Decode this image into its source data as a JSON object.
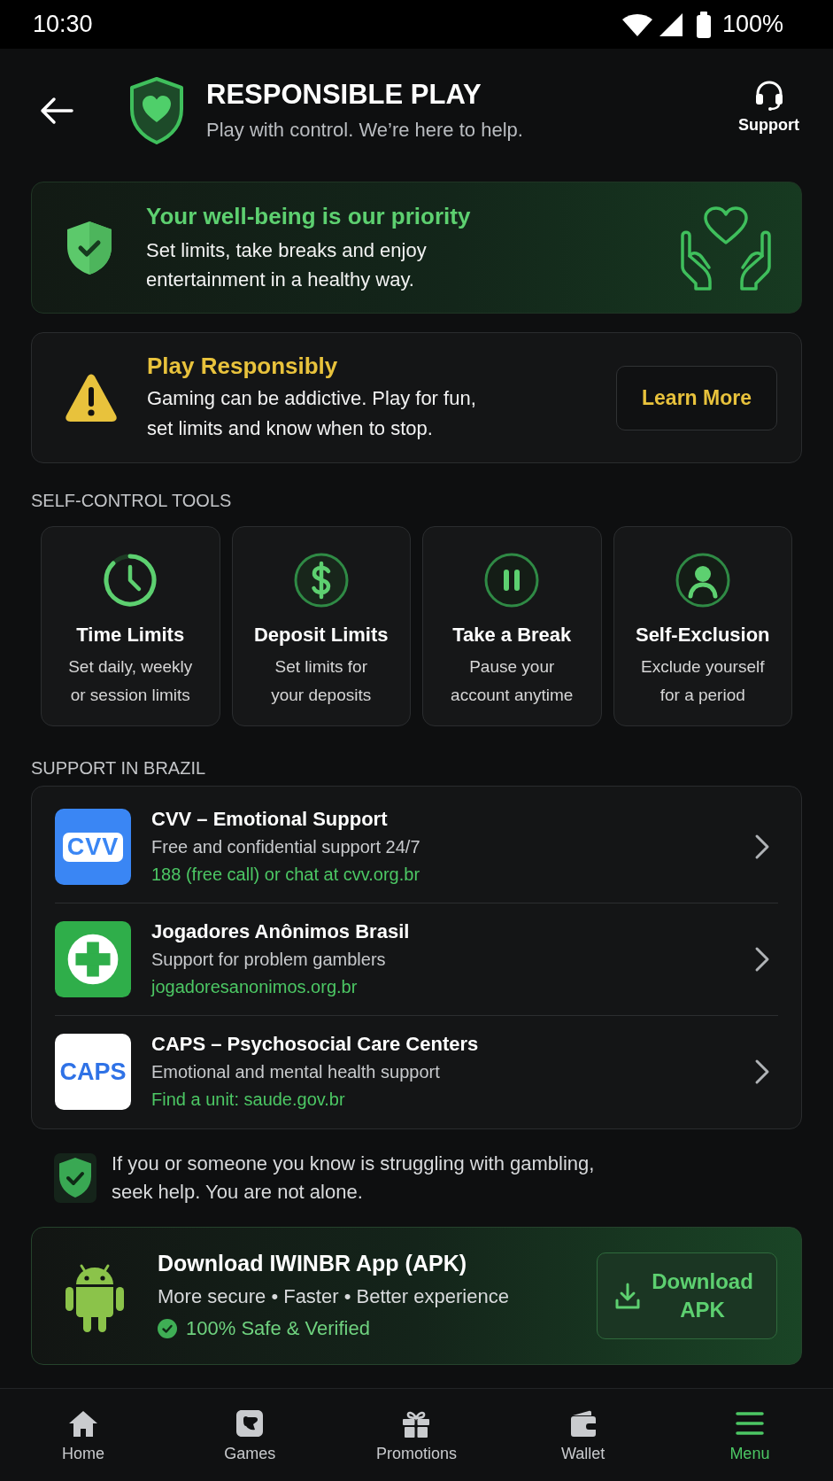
{
  "status_bar": {
    "time": "10:30",
    "battery": "100%"
  },
  "header": {
    "title": "RESPONSIBLE PLAY",
    "subtitle": "Play with control. We’re here to help.",
    "support": "Support"
  },
  "wellbeing_banner": {
    "title": "Your well-being is our priority",
    "text": "Set limits, take breaks and enjoy entertainment in a healthy way."
  },
  "warning_banner": {
    "title": "Play Responsibly",
    "text": "Gaming can be addictive. Play for fun, set limits and know when to stop.",
    "button": "Learn More"
  },
  "self_control_tools": {
    "heading": "SELF-CONTROL TOOLS",
    "items": [
      {
        "kind": "clock",
        "title": "Time Limits",
        "description": "Set daily, weekly or session limits"
      },
      {
        "kind": "dollar",
        "title": "Deposit Limits",
        "description": "Set limits for your deposits"
      },
      {
        "kind": "pause",
        "title": "Take a Break",
        "description": "Pause your account anytime"
      },
      {
        "kind": "person",
        "title": "Self-Exclusion",
        "description": "Exclude yourself for a period"
      }
    ]
  },
  "support_in_brazil": {
    "heading": "SUPPORT IN BRAZIL",
    "items": [
      {
        "kind": "boxed-text",
        "logo_text": "CVV",
        "color": "#3a86f4",
        "title": "CVV – Emotional Support",
        "description": "Free and confidential support 24/7",
        "link": "188 (free call) or chat at cvv.org.br"
      },
      {
        "kind": "cross",
        "color": "#2fae4a",
        "title": "Jogadores Anônimos Brasil",
        "description": "Support for problem gamblers",
        "link": "jogadoresanonimos.org.br"
      },
      {
        "kind": "text",
        "logo_text": "CAPS",
        "color": "#ffffff",
        "title": "CAPS – Psychosocial Care Centers",
        "description": "Emotional and mental health support",
        "link": "Find a unit: saude.gov.br"
      }
    ]
  },
  "help_note": {
    "text": "If you or someone you know is struggling with gambling, seek help. You are not alone."
  },
  "download_card": {
    "title": "Download IWINBR App (APK)",
    "subtitle": "More secure • Faster • Better experience",
    "verified": "100% Safe & Verified",
    "button": "Download APK"
  },
  "bottom_nav": [
    {
      "kind": "home",
      "label": "Home",
      "selected": false
    },
    {
      "kind": "games",
      "label": "Games",
      "selected": false
    },
    {
      "kind": "gift",
      "label": "Promotions",
      "selected": false
    },
    {
      "kind": "wallet",
      "label": "Wallet",
      "selected": false
    },
    {
      "kind": "menu",
      "label": "Menu",
      "selected": true
    }
  ]
}
